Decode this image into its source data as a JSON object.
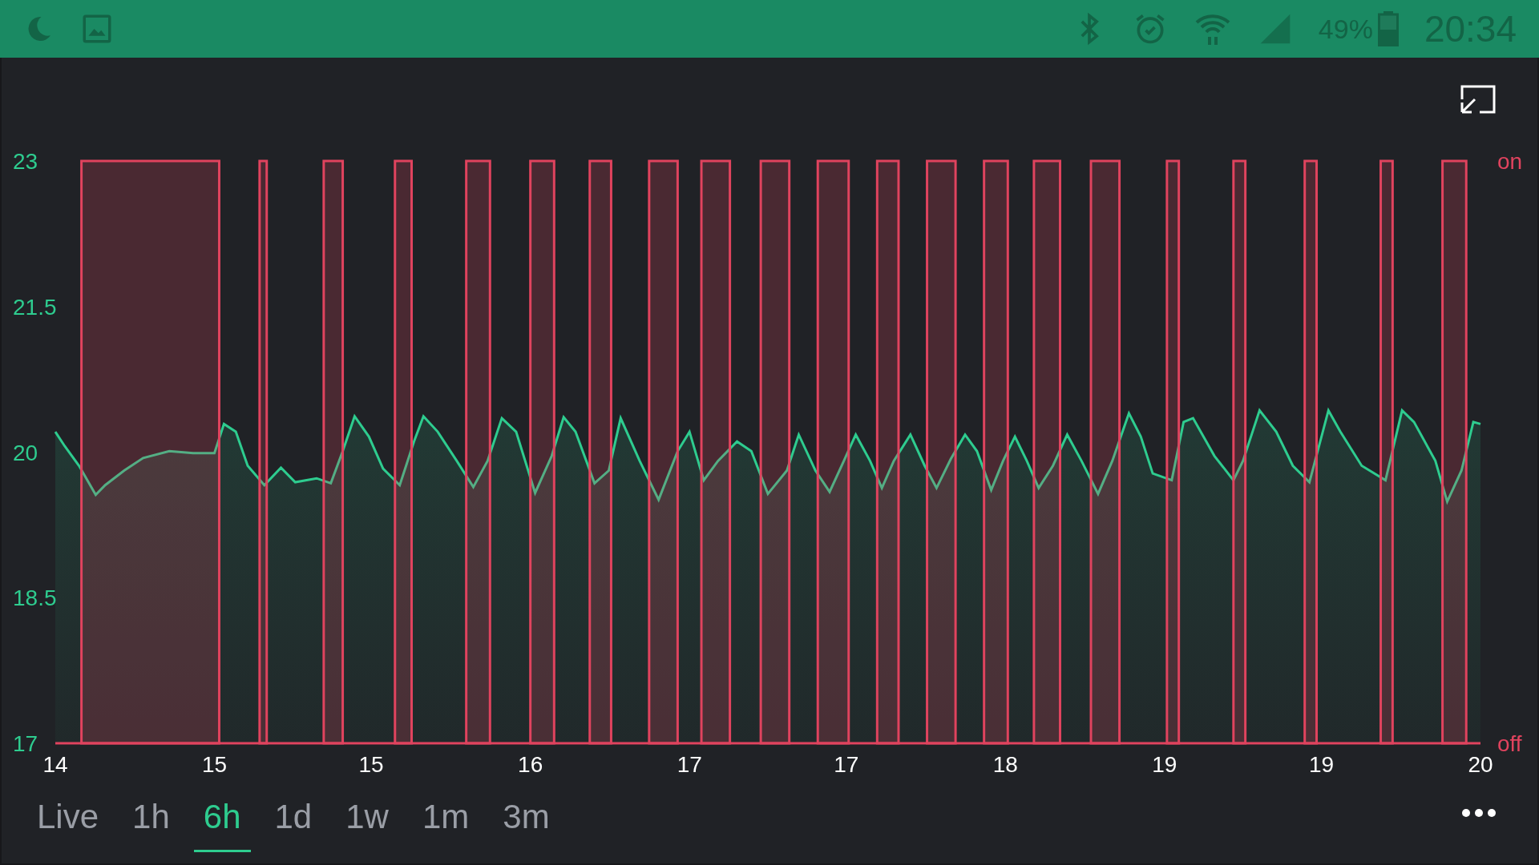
{
  "status_bar": {
    "battery_text": "49%",
    "time": "20:34"
  },
  "chart": {
    "chart_data": {
      "type": "area",
      "xlim": [
        14,
        20
      ],
      "ylim": [
        17,
        23
      ],
      "x": [
        14.0,
        14.04,
        14.1,
        14.17,
        14.21,
        14.29,
        14.37,
        14.48,
        14.58,
        14.67,
        14.71,
        14.76,
        14.81,
        14.88,
        14.95,
        15.01,
        15.1,
        15.16,
        15.21,
        15.26,
        15.32,
        15.38,
        15.45,
        15.51,
        15.55,
        15.61,
        15.69,
        15.76,
        15.82,
        15.88,
        15.94,
        16.02,
        16.09,
        16.14,
        16.19,
        16.27,
        16.33,
        16.38,
        16.46,
        16.54,
        16.62,
        16.67,
        16.73,
        16.79,
        16.87,
        16.93,
        17.0,
        17.08,
        17.13,
        17.2,
        17.26,
        17.32,
        17.37,
        17.43,
        17.48,
        17.53,
        17.6,
        17.66,
        17.71,
        17.77,
        17.83,
        17.88,
        17.94,
        17.99,
        18.04,
        18.09,
        18.14,
        18.2,
        18.26,
        18.32,
        18.39,
        18.45,
        18.52,
        18.57,
        18.62,
        18.7,
        18.75,
        18.79,
        18.88,
        18.96,
        19.0,
        19.07,
        19.14,
        19.21,
        19.28,
        19.36,
        19.41,
        19.5,
        19.6,
        19.67,
        19.72,
        19.81,
        19.86,
        19.92,
        19.97,
        20.0
      ],
      "series": [
        {
          "color": "#2ecc8f",
          "values": [
            20.21,
            20.06,
            19.86,
            19.56,
            19.66,
            19.81,
            19.94,
            20.01,
            19.99,
            19.99,
            20.29,
            20.21,
            19.86,
            19.66,
            19.84,
            19.69,
            19.73,
            19.68,
            20.01,
            20.37,
            20.16,
            19.83,
            19.66,
            20.11,
            20.37,
            20.21,
            19.91,
            19.64,
            19.91,
            20.35,
            20.21,
            19.58,
            19.96,
            20.36,
            20.21,
            19.68,
            19.81,
            20.35,
            19.91,
            19.51,
            20.01,
            20.21,
            19.71,
            19.91,
            20.11,
            20.01,
            19.57,
            19.81,
            20.18,
            19.81,
            19.59,
            19.91,
            20.18,
            19.91,
            19.63,
            19.91,
            20.18,
            19.86,
            19.63,
            19.93,
            20.18,
            20.01,
            19.61,
            19.91,
            20.16,
            19.91,
            19.63,
            19.86,
            20.18,
            19.91,
            19.57,
            19.91,
            20.4,
            20.16,
            19.78,
            19.71,
            20.31,
            20.35,
            19.96,
            19.71,
            19.91,
            20.43,
            20.21,
            19.86,
            19.69,
            20.43,
            20.21,
            19.86,
            19.71,
            20.43,
            20.31,
            19.91,
            19.49,
            19.81,
            20.31,
            20.29
          ]
        }
      ],
      "xticks": [
        {
          "value": 14,
          "label": "14"
        },
        {
          "value": 14.67,
          "label": "15"
        },
        {
          "value": 15.33,
          "label": "15"
        },
        {
          "value": 16,
          "label": "16"
        },
        {
          "value": 16.67,
          "label": "17"
        },
        {
          "value": 17.33,
          "label": "17"
        },
        {
          "value": 18,
          "label": "18"
        },
        {
          "value": 18.67,
          "label": "19"
        },
        {
          "value": 19.33,
          "label": "19"
        },
        {
          "value": 20,
          "label": "20"
        }
      ],
      "yticks": [
        {
          "value": 23,
          "label": "23"
        },
        {
          "value": 21.5,
          "label": "21.5"
        },
        {
          "value": 20,
          "label": "20"
        },
        {
          "value": 18.5,
          "label": "18.5"
        },
        {
          "value": 17,
          "label": "17"
        }
      ],
      "bands": [
        {
          "axis": "x",
          "from": 14.11,
          "to": 14.69,
          "color": "#e0435e"
        },
        {
          "axis": "x",
          "from": 14.86,
          "to": 14.89,
          "color": "#e0435e"
        },
        {
          "axis": "x",
          "from": 15.13,
          "to": 15.21,
          "color": "#e0435e"
        },
        {
          "axis": "x",
          "from": 15.43,
          "to": 15.5,
          "color": "#e0435e"
        },
        {
          "axis": "x",
          "from": 15.73,
          "to": 15.83,
          "color": "#e0435e"
        },
        {
          "axis": "x",
          "from": 16.0,
          "to": 16.1,
          "color": "#e0435e"
        },
        {
          "axis": "x",
          "from": 16.25,
          "to": 16.34,
          "color": "#e0435e"
        },
        {
          "axis": "x",
          "from": 16.5,
          "to": 16.62,
          "color": "#e0435e"
        },
        {
          "axis": "x",
          "from": 16.72,
          "to": 16.84,
          "color": "#e0435e"
        },
        {
          "axis": "x",
          "from": 16.97,
          "to": 17.09,
          "color": "#e0435e"
        },
        {
          "axis": "x",
          "from": 17.21,
          "to": 17.34,
          "color": "#e0435e"
        },
        {
          "axis": "x",
          "from": 17.46,
          "to": 17.55,
          "color": "#e0435e"
        },
        {
          "axis": "x",
          "from": 17.67,
          "to": 17.79,
          "color": "#e0435e"
        },
        {
          "axis": "x",
          "from": 17.91,
          "to": 18.01,
          "color": "#e0435e"
        },
        {
          "axis": "x",
          "from": 18.12,
          "to": 18.23,
          "color": "#e0435e"
        },
        {
          "axis": "x",
          "from": 18.36,
          "to": 18.48,
          "color": "#e0435e"
        },
        {
          "axis": "x",
          "from": 18.68,
          "to": 18.73,
          "color": "#e0435e"
        },
        {
          "axis": "x",
          "from": 18.96,
          "to": 19.01,
          "color": "#e0435e"
        },
        {
          "axis": "x",
          "from": 19.26,
          "to": 19.31,
          "color": "#e0435e"
        },
        {
          "axis": "x",
          "from": 19.58,
          "to": 19.63,
          "color": "#e0435e"
        },
        {
          "axis": "x",
          "from": 19.84,
          "to": 19.94,
          "color": "#e0435e"
        }
      ]
    },
    "state_labels": [
      {
        "kind": "top",
        "label": "on"
      },
      {
        "kind": "bottom",
        "label": "off"
      }
    ]
  },
  "range_tabs": [
    {
      "label": "Live",
      "selected": false
    },
    {
      "label": "1h",
      "selected": false
    },
    {
      "label": "6h",
      "selected": true
    },
    {
      "label": "1d",
      "selected": false
    },
    {
      "label": "1w",
      "selected": false
    },
    {
      "label": "1m",
      "selected": false
    },
    {
      "label": "3m",
      "selected": false
    }
  ]
}
